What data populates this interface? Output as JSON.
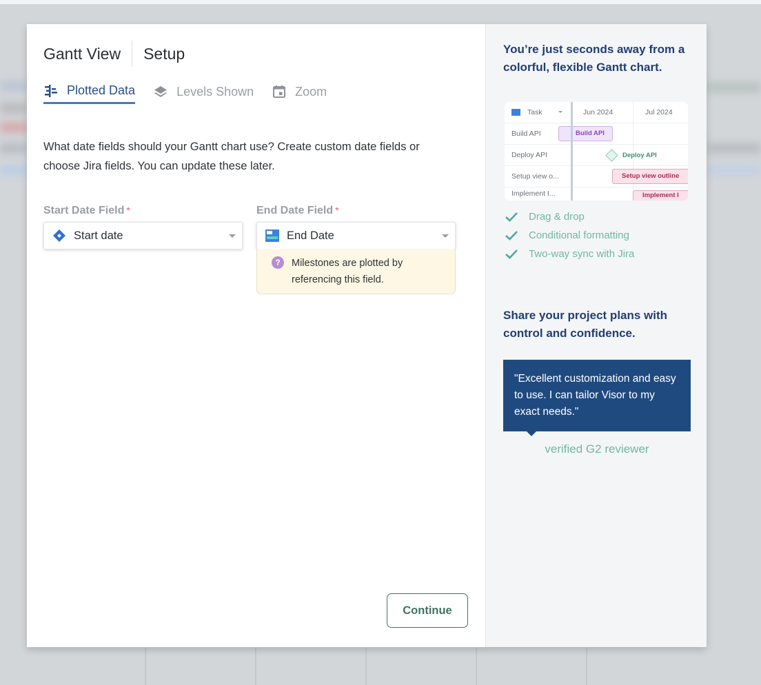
{
  "modal": {
    "title": "Gantt View",
    "subtitle": "Setup",
    "tabs": [
      {
        "label": "Plotted Data",
        "icon": "plotted-data-icon",
        "active": true
      },
      {
        "label": "Levels Shown",
        "icon": "layers-icon",
        "active": false
      },
      {
        "label": "Zoom",
        "icon": "calendar-icon",
        "active": false
      }
    ],
    "description": "What date fields should your Gantt chart use? Create custom date fields or choose Jira fields. You can update these later.",
    "start_field": {
      "label": "Start Date Field",
      "required_mark": "*",
      "value": "Start date",
      "icon": "jira-diamond-icon"
    },
    "end_field": {
      "label": "End Date Field",
      "required_mark": "*",
      "value": "End Date",
      "icon": "custom-field-icon",
      "hint": "Milestones are plotted by referencing this field.",
      "hint_icon": "question-icon"
    },
    "continue_label": "Continue"
  },
  "promo": {
    "headline1": "You’re just seconds away from a colorful, flexible Gantt chart.",
    "preview": {
      "column_header": "Task",
      "months": [
        "Jun 2024",
        "Jul 2024"
      ],
      "rows": [
        {
          "task": "Build API",
          "bar_label": "Build API",
          "type": "bar"
        },
        {
          "task": "Deploy API",
          "bar_label": "Deploy API",
          "type": "milestone"
        },
        {
          "task": "Setup view o...",
          "bar_label": "Setup view outline",
          "type": "bar"
        },
        {
          "task": "Implement I...",
          "bar_label": "Implement I",
          "type": "bar"
        }
      ]
    },
    "features": [
      "Drag & drop",
      "Conditional formatting",
      "Two-way sync with Jira"
    ],
    "headline2": "Share your project plans with control and confidence.",
    "quote": "\"Excellent customization and easy to use. I can tailor Visor to my exact needs.\"",
    "reviewer": "verified G2 reviewer"
  },
  "colors": {
    "accent_blue": "#2a4f86",
    "tab_underline": "#4a78b8",
    "navy": "#203f73",
    "quote_bg": "#1f4a80",
    "teal": "#6fb8a2",
    "continue_green": "#3e7462",
    "hint_bg": "#fdf7e4",
    "required_red": "#e0605a"
  }
}
